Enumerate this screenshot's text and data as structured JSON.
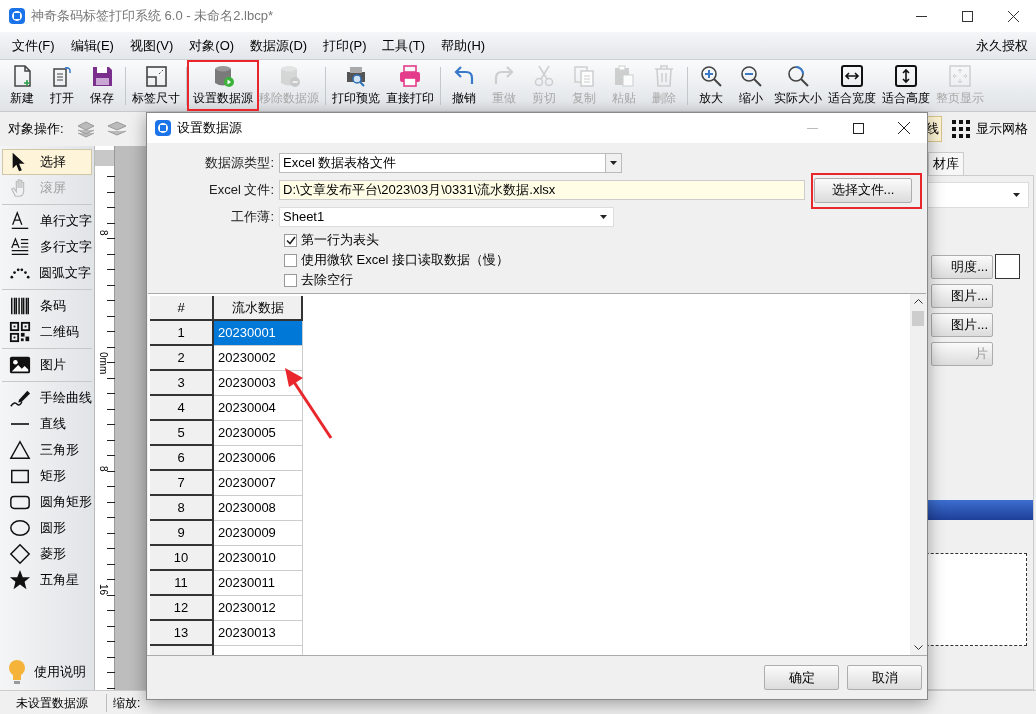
{
  "window": {
    "title": "神奇条码标签打印系统 6.0 - 未命名2.lbcp*"
  },
  "menu": [
    "文件(F)",
    "编辑(E)",
    "视图(V)",
    "对象(O)",
    "数据源(D)",
    "打印(P)",
    "工具(T)",
    "帮助(H)"
  ],
  "license": "永久授权",
  "toolbar": [
    [
      {
        "label": "新建",
        "disabled": false
      },
      {
        "label": "打开",
        "disabled": false
      },
      {
        "label": "保存",
        "disabled": false
      }
    ],
    [
      {
        "label": "标签尺寸",
        "disabled": false
      }
    ],
    [
      {
        "label": "设置数据源",
        "disabled": false
      },
      {
        "label": "移除数据源",
        "disabled": true
      }
    ],
    [
      {
        "label": "打印预览",
        "disabled": false
      },
      {
        "label": "直接打印",
        "disabled": false
      }
    ],
    [
      {
        "label": "撤销",
        "disabled": false
      },
      {
        "label": "重做",
        "disabled": true
      },
      {
        "label": "剪切",
        "disabled": true
      },
      {
        "label": "复制",
        "disabled": true
      },
      {
        "label": "粘贴",
        "disabled": true
      },
      {
        "label": "删除",
        "disabled": true
      }
    ],
    [
      {
        "label": "放大",
        "disabled": false
      },
      {
        "label": "缩小",
        "disabled": false
      },
      {
        "label": "实际大小",
        "disabled": false
      },
      {
        "label": "适合宽度",
        "disabled": false
      },
      {
        "label": "适合高度",
        "disabled": false
      },
      {
        "label": "整页显示",
        "disabled": true
      }
    ]
  ],
  "object_bar": {
    "label": "对象操作:",
    "toggle": {
      "label": "线",
      "on": true
    },
    "grid_button": "显示网格"
  },
  "palette": [
    [
      {
        "label": "选择",
        "selected": true,
        "disabled": false
      },
      {
        "label": "滚屏",
        "selected": false,
        "disabled": true
      }
    ],
    [
      {
        "label": "单行文字",
        "selected": false,
        "disabled": false
      },
      {
        "label": "多行文字",
        "selected": false,
        "disabled": false
      },
      {
        "label": "圆弧文字",
        "selected": false,
        "disabled": false
      }
    ],
    [
      {
        "label": "条码",
        "selected": false,
        "disabled": false
      },
      {
        "label": "二维码",
        "selected": false,
        "disabled": false
      }
    ],
    [
      {
        "label": "图片",
        "selected": false,
        "disabled": false
      }
    ],
    [
      {
        "label": "手绘曲线",
        "selected": false,
        "disabled": false
      },
      {
        "label": "直线",
        "selected": false,
        "disabled": false
      },
      {
        "label": "三角形",
        "selected": false,
        "disabled": false
      },
      {
        "label": "矩形",
        "selected": false,
        "disabled": false
      },
      {
        "label": "圆角矩形",
        "selected": false,
        "disabled": false
      },
      {
        "label": "圆形",
        "selected": false,
        "disabled": false
      },
      {
        "label": "菱形",
        "selected": false,
        "disabled": false
      },
      {
        "label": "五角星",
        "selected": false,
        "disabled": false
      }
    ]
  ],
  "help": "使用说明",
  "ruler": [
    "8",
    "0mm",
    "8",
    "16"
  ],
  "right_panel": {
    "tab": "材库",
    "buttons": [
      {
        "label": "明度...",
        "disabled": false
      },
      {
        "label": "图片...",
        "disabled": false
      },
      {
        "label": "图片...",
        "disabled": false
      },
      {
        "label": "片",
        "disabled": true
      }
    ]
  },
  "status_bar": [
    "未设置数据源",
    "缩放:"
  ],
  "dialog": {
    "title": "设置数据源",
    "fields": [
      {
        "label": "数据源类型:",
        "value": "Excel 数据表格文件",
        "kind": "combo"
      },
      {
        "label": "Excel 文件:",
        "value": "D:\\文章发布平台\\2023\\03月\\0331\\流水数据.xlsx",
        "kind": "path"
      },
      {
        "label": "工作薄:",
        "value": "Sheet1",
        "kind": "dropdown"
      }
    ],
    "browse_button": "选择文件...",
    "options": [
      {
        "label": "第一行为表头",
        "checked": true
      },
      {
        "label": "使用微软 Excel 接口读取数据（慢）",
        "checked": false
      },
      {
        "label": "去除空行",
        "checked": false
      }
    ],
    "table": {
      "columns": [
        "#",
        "流水数据"
      ],
      "rows": [
        {
          "cells": [
            "1",
            "20230001"
          ],
          "selected": true
        },
        {
          "cells": [
            "2",
            "20230002"
          ],
          "selected": false
        },
        {
          "cells": [
            "3",
            "20230003"
          ],
          "selected": false
        },
        {
          "cells": [
            "4",
            "20230004"
          ],
          "selected": false
        },
        {
          "cells": [
            "5",
            "20230005"
          ],
          "selected": false
        },
        {
          "cells": [
            "6",
            "20230006"
          ],
          "selected": false
        },
        {
          "cells": [
            "7",
            "20230007"
          ],
          "selected": false
        },
        {
          "cells": [
            "8",
            "20230008"
          ],
          "selected": false
        },
        {
          "cells": [
            "9",
            "20230009"
          ],
          "selected": false
        },
        {
          "cells": [
            "10",
            "20230010"
          ],
          "selected": false
        },
        {
          "cells": [
            "11",
            "20230011"
          ],
          "selected": false
        },
        {
          "cells": [
            "12",
            "20230012"
          ],
          "selected": false
        },
        {
          "cells": [
            "13",
            "20230013"
          ],
          "selected": false
        }
      ]
    },
    "buttons": [
      "确定",
      "取消"
    ]
  }
}
